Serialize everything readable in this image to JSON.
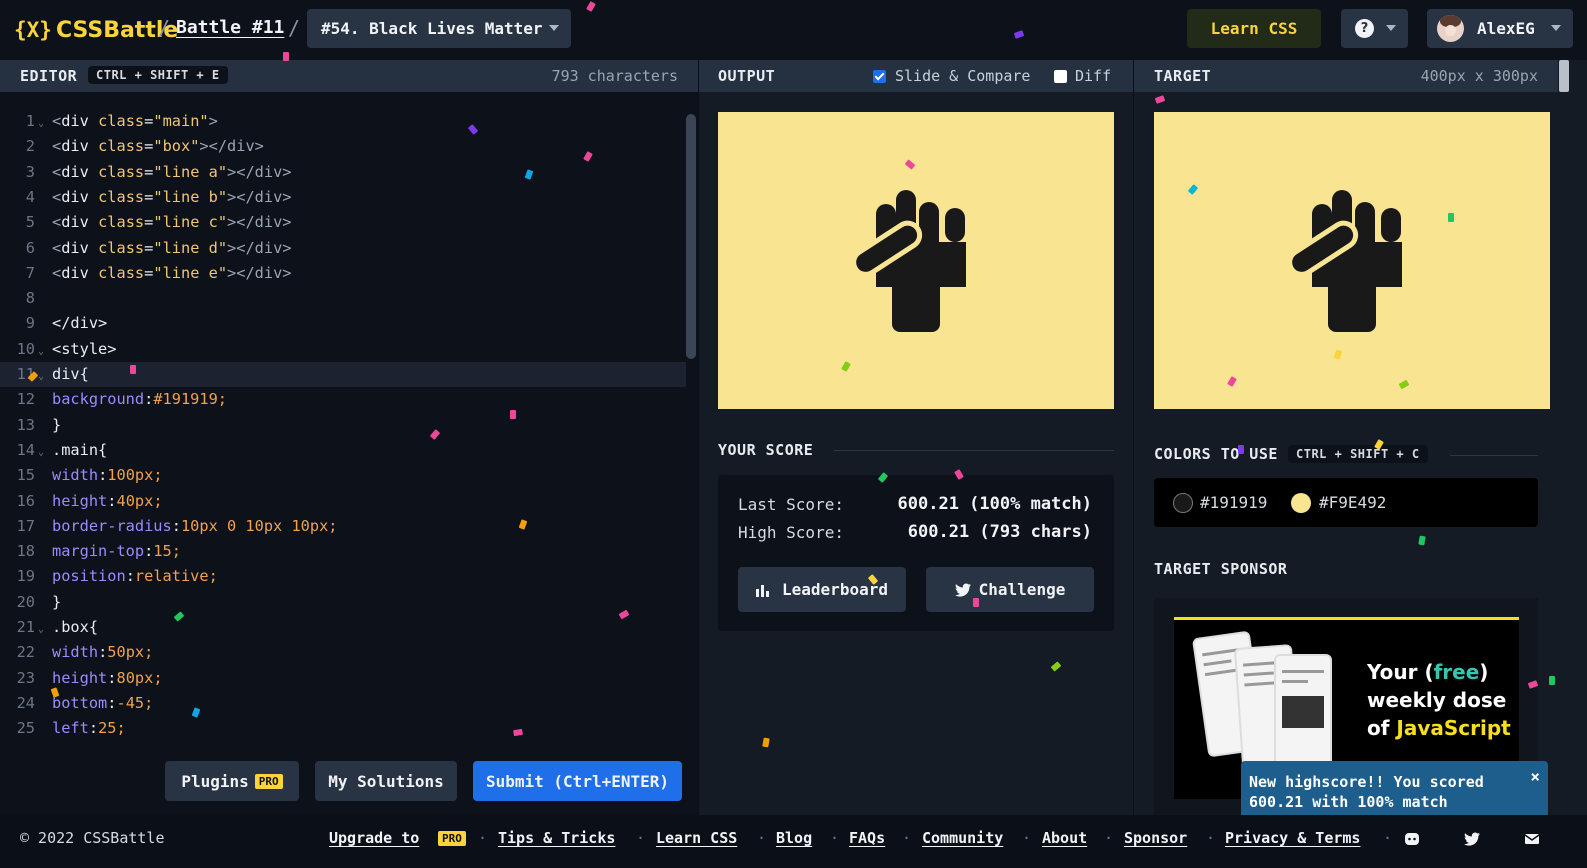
{
  "header": {
    "logo_mark": "{X}",
    "logo_text": "CSSBattle",
    "breadcrumb_sep": "/",
    "battle_link": "Battle #11",
    "battle_select": "#54. Black Lives Matter",
    "learn_css": "Learn CSS",
    "help_icon": "?",
    "username": "AlexEG"
  },
  "editor": {
    "title": "EDITOR",
    "shortcut": "CTRL + SHIFT + E",
    "char_count": "793 characters",
    "active_line": 11,
    "lines": [
      {
        "n": "1",
        "fold": true,
        "text": "<div class=\"main\">"
      },
      {
        "n": "2",
        "fold": false,
        "text": "<div class=\"box\"></div>"
      },
      {
        "n": "3",
        "fold": false,
        "text": "<div class=\"line a\"></div>"
      },
      {
        "n": "4",
        "fold": false,
        "text": "<div class=\"line b\"></div>"
      },
      {
        "n": "5",
        "fold": false,
        "text": "<div class=\"line c\"></div>"
      },
      {
        "n": "6",
        "fold": false,
        "text": "<div class=\"line d\"></div>"
      },
      {
        "n": "7",
        "fold": false,
        "text": "<div class=\"line e\"></div>"
      },
      {
        "n": "8",
        "fold": false,
        "text": ""
      },
      {
        "n": "9",
        "fold": false,
        "text": "</div>"
      },
      {
        "n": "10",
        "fold": true,
        "text": "<style>"
      },
      {
        "n": "11",
        "fold": true,
        "text": "div{"
      },
      {
        "n": "12",
        "fold": false,
        "text": "background:#191919;"
      },
      {
        "n": "13",
        "fold": false,
        "text": "}"
      },
      {
        "n": "14",
        "fold": true,
        "text": ".main{"
      },
      {
        "n": "15",
        "fold": false,
        "text": "width:100px;"
      },
      {
        "n": "16",
        "fold": false,
        "text": "height:40px;"
      },
      {
        "n": "17",
        "fold": false,
        "text": "border-radius:10px 0 10px 10px;"
      },
      {
        "n": "18",
        "fold": false,
        "text": "margin-top:15;"
      },
      {
        "n": "19",
        "fold": false,
        "text": "position:relative;"
      },
      {
        "n": "20",
        "fold": false,
        "text": "}"
      },
      {
        "n": "21",
        "fold": true,
        "text": ".box{"
      },
      {
        "n": "22",
        "fold": false,
        "text": "width:50px;"
      },
      {
        "n": "23",
        "fold": false,
        "text": "height:80px;"
      },
      {
        "n": "24",
        "fold": false,
        "text": "bottom:-45;"
      },
      {
        "n": "25",
        "fold": false,
        "text": "left:25;"
      }
    ],
    "plugins_label": "Plugins",
    "pro_badge": "PRO",
    "my_solutions_label": "My Solutions",
    "submit_label": "Submit (Ctrl+ENTER)"
  },
  "output": {
    "title": "OUTPUT",
    "slide_compare_label": "Slide & Compare",
    "slide_compare_checked": true,
    "diff_label": "Diff",
    "diff_checked": false
  },
  "target": {
    "title": "TARGET",
    "dimensions": "400px x 300px"
  },
  "score": {
    "title": "YOUR SCORE",
    "last_label": "Last Score:",
    "last_value": "600.21 (100% match)",
    "high_label": "High Score:",
    "high_value": "600.21 (793 chars)",
    "leaderboard_label": "Leaderboard",
    "challenge_label": "Challenge"
  },
  "colors": {
    "title": "COLORS TO USE",
    "shortcut": "CTRL + SHIFT + C",
    "items": [
      {
        "hex": "#191919",
        "label": "#191919"
      },
      {
        "hex": "#F9E492",
        "label": "#F9E492"
      }
    ]
  },
  "sponsor": {
    "title": "TARGET SPONSOR",
    "ad_line1_a": "Your (",
    "ad_line1_b": "free",
    "ad_line1_c": ")",
    "ad_line2": "weekly dose",
    "ad_line3_a": "of ",
    "ad_line3_b": "JavaScript"
  },
  "toast": {
    "text": "New highscore!! You scored 600.21 with 100% match",
    "close": "×"
  },
  "footer": {
    "copyright": "© 2022 CSSBattle",
    "upgrade": "Upgrade to",
    "pro_badge": "PRO",
    "links": [
      "Tips & Tricks",
      "Learn CSS",
      "Blog",
      "FAQs",
      "Community",
      "About",
      "Sponsor",
      "Privacy & Terms"
    ],
    "separator": "·"
  },
  "theme": {
    "accent_yellow": "#fbd33b",
    "submit_blue": "#1f6feb",
    "canvas_bg": "#f9e492",
    "shape_color": "#191919"
  }
}
